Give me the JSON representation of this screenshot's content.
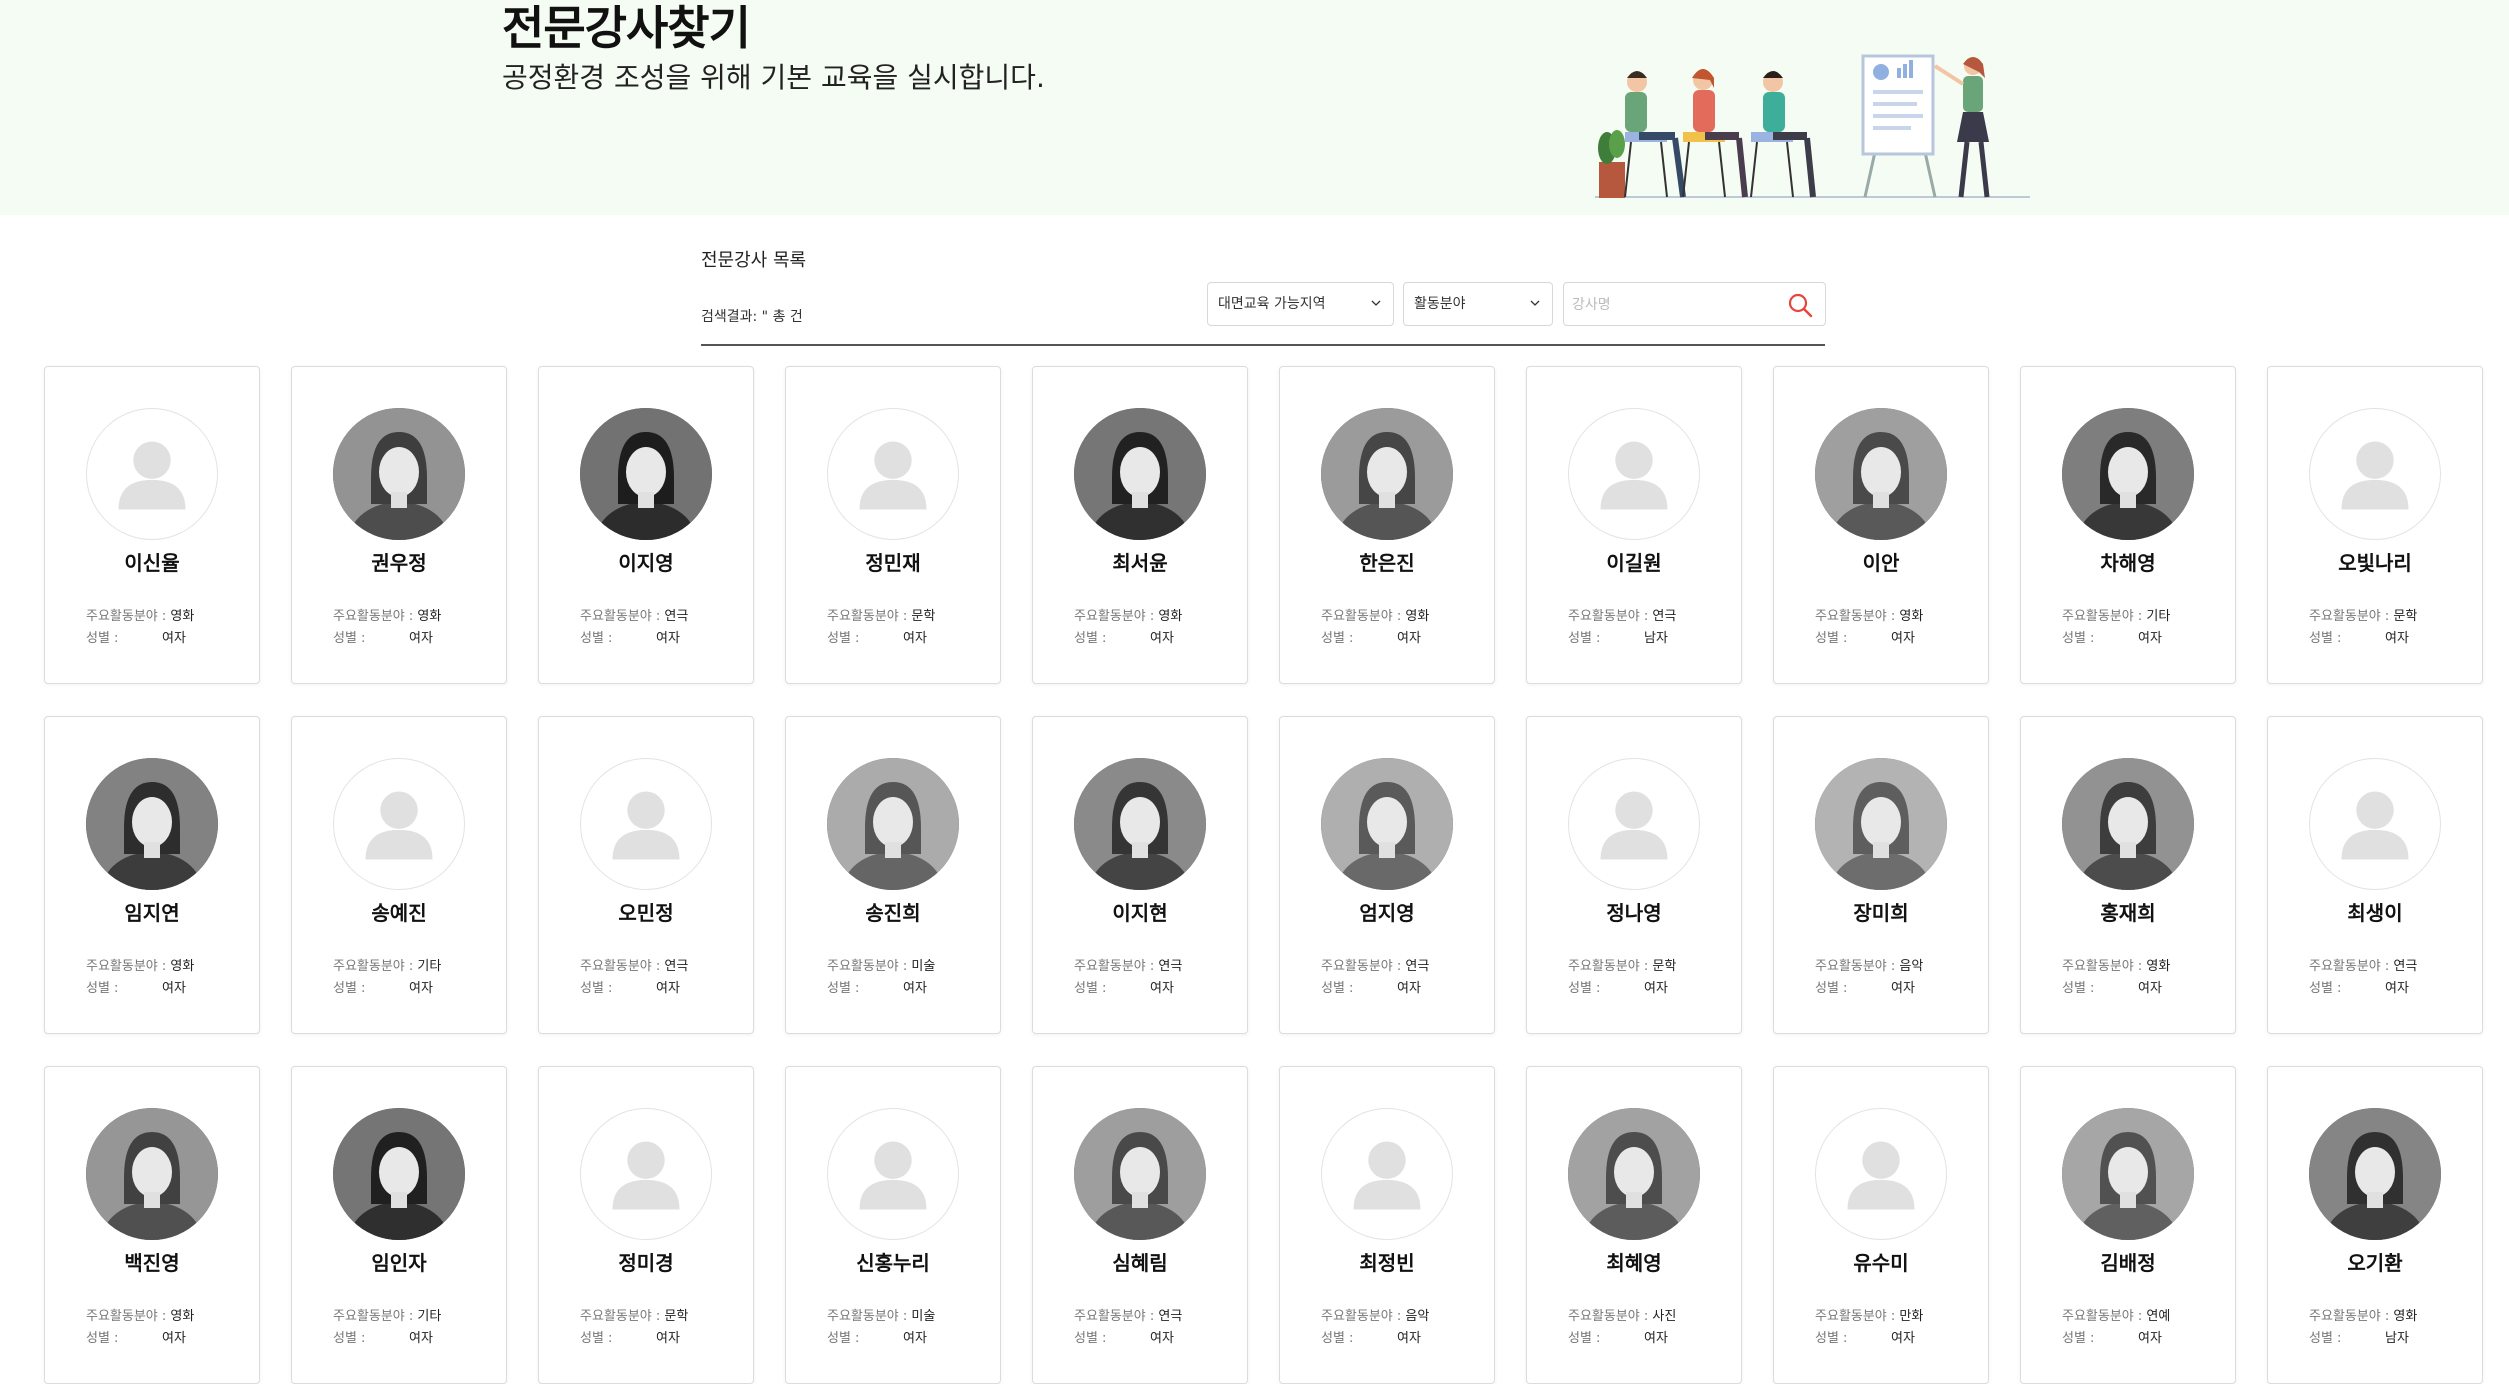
{
  "hero": {
    "title": "전문강사찾기",
    "subtitle": "공정환경 조성을 위해 기본 교육을 실시합니다."
  },
  "list": {
    "title": "전문강사 목록",
    "result_text": "검색결과: \" 총 건",
    "region_select": "대면교육 가능지역",
    "field_select": "활동분야",
    "search_placeholder": "강사명"
  },
  "labels": {
    "field": "주요활동분야 : ",
    "gender": "성별 :"
  },
  "colors": {
    "hero_bg": "#f5fcf3",
    "accent": "#e8453c"
  },
  "instructors": [
    {
      "name": "이신율",
      "field": "영화",
      "gender": "여자",
      "photo": false
    },
    {
      "name": "권우정",
      "field": "영화",
      "gender": "여자",
      "photo": true
    },
    {
      "name": "이지영",
      "field": "연극",
      "gender": "여자",
      "photo": true
    },
    {
      "name": "정민재",
      "field": "문학",
      "gender": "여자",
      "photo": false
    },
    {
      "name": "최서윤",
      "field": "영화",
      "gender": "여자",
      "photo": true
    },
    {
      "name": "한은진",
      "field": "영화",
      "gender": "여자",
      "photo": true
    },
    {
      "name": "이길원",
      "field": "연극",
      "gender": "남자",
      "photo": false
    },
    {
      "name": "이안",
      "field": "영화",
      "gender": "여자",
      "photo": true
    },
    {
      "name": "차해영",
      "field": "기타",
      "gender": "여자",
      "photo": true
    },
    {
      "name": "오빛나리",
      "field": "문학",
      "gender": "여자",
      "photo": false
    },
    {
      "name": "임지연",
      "field": "영화",
      "gender": "여자",
      "photo": true
    },
    {
      "name": "송예진",
      "field": "기타",
      "gender": "여자",
      "photo": false
    },
    {
      "name": "오민정",
      "field": "연극",
      "gender": "여자",
      "photo": false
    },
    {
      "name": "송진희",
      "field": "미술",
      "gender": "여자",
      "photo": true
    },
    {
      "name": "이지현",
      "field": "연극",
      "gender": "여자",
      "photo": true
    },
    {
      "name": "엄지영",
      "field": "연극",
      "gender": "여자",
      "photo": true
    },
    {
      "name": "정나영",
      "field": "문학",
      "gender": "여자",
      "photo": false
    },
    {
      "name": "장미희",
      "field": "음악",
      "gender": "여자",
      "photo": true
    },
    {
      "name": "홍재희",
      "field": "영화",
      "gender": "여자",
      "photo": true
    },
    {
      "name": "최생이",
      "field": "연극",
      "gender": "여자",
      "photo": false
    },
    {
      "name": "백진영",
      "field": "영화",
      "gender": "여자",
      "photo": true
    },
    {
      "name": "임인자",
      "field": "기타",
      "gender": "여자",
      "photo": true
    },
    {
      "name": "정미경",
      "field": "문학",
      "gender": "여자",
      "photo": false
    },
    {
      "name": "신홍누리",
      "field": "미술",
      "gender": "여자",
      "photo": false
    },
    {
      "name": "심혜림",
      "field": "연극",
      "gender": "여자",
      "photo": true
    },
    {
      "name": "최정빈",
      "field": "음악",
      "gender": "여자",
      "photo": false
    },
    {
      "name": "최혜영",
      "field": "사진",
      "gender": "여자",
      "photo": true
    },
    {
      "name": "유수미",
      "field": "만화",
      "gender": "여자",
      "photo": false
    },
    {
      "name": "김배정",
      "field": "연예",
      "gender": "여자",
      "photo": true
    },
    {
      "name": "오기환",
      "field": "영화",
      "gender": "남자",
      "photo": true
    }
  ]
}
